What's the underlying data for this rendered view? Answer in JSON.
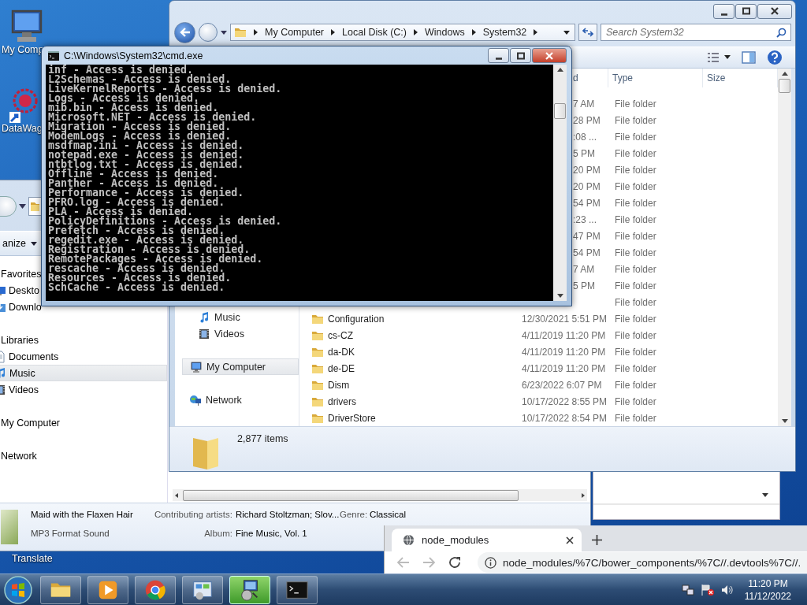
{
  "desktop_icons": [
    {
      "label": "My Comp",
      "kind": "computer"
    },
    {
      "label": "DataWag",
      "kind": "sphere"
    },
    {
      "label": "Translate",
      "kind": "none"
    }
  ],
  "back_explorer": {
    "toolbar_label": "anize",
    "nav_items": [
      {
        "label": "Favorites",
        "kind": "header",
        "selected": false
      },
      {
        "label": "Deskto",
        "kind": "desktop",
        "selected": false
      },
      {
        "label": "Downlo",
        "kind": "download",
        "selected": false
      },
      {
        "label": "Libraries",
        "kind": "header",
        "selected": false
      },
      {
        "label": "Documents",
        "kind": "document",
        "selected": false
      },
      {
        "label": "Music",
        "kind": "music",
        "selected": true
      },
      {
        "label": "Videos",
        "kind": "video",
        "selected": false
      },
      {
        "label": "My Computer",
        "kind": "header",
        "selected": false
      },
      {
        "label": "Network",
        "kind": "header",
        "selected": false
      }
    ],
    "details": {
      "title": "Maid with the Flaxen Hair",
      "file_type": "MP3 Format Sound",
      "fields": [
        {
          "label": "Contributing artists:",
          "value": "Richard Stoltzman; Slov..."
        },
        {
          "label": "Album:",
          "value": "Fine Music, Vol. 1"
        },
        {
          "label": "Genre:",
          "value": "Classical"
        }
      ]
    }
  },
  "explorer": {
    "breadcrumb": [
      "My Computer",
      "Local Disk (C:)",
      "Windows",
      "System32"
    ],
    "search": {
      "placeholder": "Search System32"
    },
    "columns": [
      "d",
      "Type",
      "Size"
    ],
    "nav_items": [
      {
        "label": "Music",
        "kind": "music",
        "selected": false
      },
      {
        "label": "Videos",
        "kind": "video",
        "selected": false
      },
      {
        "label": "My Computer",
        "kind": "computer",
        "selected": true
      },
      {
        "label": "Network",
        "kind": "network",
        "selected": false
      }
    ],
    "rows": [
      {
        "date": "7 AM",
        "type": "File folder"
      },
      {
        "date": "28 PM",
        "type": "File folder"
      },
      {
        "date": ":08 ...",
        "type": "File folder"
      },
      {
        "date": "5 PM",
        "type": "File folder"
      },
      {
        "date": "20 PM",
        "type": "File folder"
      },
      {
        "date": "20 PM",
        "type": "File folder"
      },
      {
        "date": "54 PM",
        "type": "File folder"
      },
      {
        "date": ":23 ...",
        "type": "File folder"
      },
      {
        "date": "47 PM",
        "type": "File folder"
      },
      {
        "date": "54 PM",
        "type": "File folder"
      },
      {
        "date": "7 AM",
        "type": "File folder"
      },
      {
        "date": "5 PM",
        "type": "File folder"
      },
      {
        "type": "File folder"
      },
      {
        "name": "Configuration",
        "date": "12/30/2021 5:51 PM",
        "type": "File folder"
      },
      {
        "name": "cs-CZ",
        "date": "4/11/2019 11:20 PM",
        "type": "File folder"
      },
      {
        "name": "da-DK",
        "date": "4/11/2019 11:20 PM",
        "type": "File folder"
      },
      {
        "name": "de-DE",
        "date": "4/11/2019 11:20 PM",
        "type": "File folder"
      },
      {
        "name": "Dism",
        "date": "6/23/2022 6:07 PM",
        "type": "File folder"
      },
      {
        "name": "drivers",
        "date": "10/17/2022 8:55 PM",
        "type": "File folder"
      },
      {
        "name": "DriverStore",
        "date": "10/17/2022 8:54 PM",
        "type": "File folder"
      }
    ],
    "status": "2,877 items"
  },
  "console": {
    "title": "C:\\Windows\\System32\\cmd.exe",
    "lines": [
      "inf - Access is denied.",
      "L2Schemas - Access is denied.",
      "LiveKernelReports - Access is denied.",
      "Logs - Access is denied.",
      "mib.bin - Access is denied.",
      "Microsoft.NET - Access is denied.",
      "Migration - Access is denied.",
      "ModemLogs - Access is denied.",
      "msdfmap.ini - Access is denied.",
      "notepad.exe - Access is denied.",
      "ntbtlog.txt - Access is denied.",
      "Offline - Access is denied.",
      "Panther - Access is denied.",
      "Performance - Access is denied.",
      "PFRO.log - Access is denied.",
      "PLA - Access is denied.",
      "PolicyDefinitions - Access is denied.",
      "Prefetch - Access is denied.",
      "regedit.exe - Access is denied.",
      "Registration - Access is denied.",
      "RemotePackages - Access is denied.",
      "rescache - Access is denied.",
      "Resources - Access is denied.",
      "SchCache - Access is denied."
    ]
  },
  "browser": {
    "tab": "node_modules",
    "url": "node_modules/%7C/bower_components/%7C//.devtools%7C//."
  },
  "taskbar": {
    "apps": [
      {
        "kind": "explorer",
        "active": false
      },
      {
        "kind": "media",
        "active": false
      },
      {
        "kind": "chrome",
        "active": false
      },
      {
        "kind": "control",
        "active": false
      },
      {
        "kind": "installer",
        "active": true
      },
      {
        "kind": "console",
        "active": false
      }
    ],
    "time": "11:20 PM",
    "date": "11/12/2022"
  }
}
